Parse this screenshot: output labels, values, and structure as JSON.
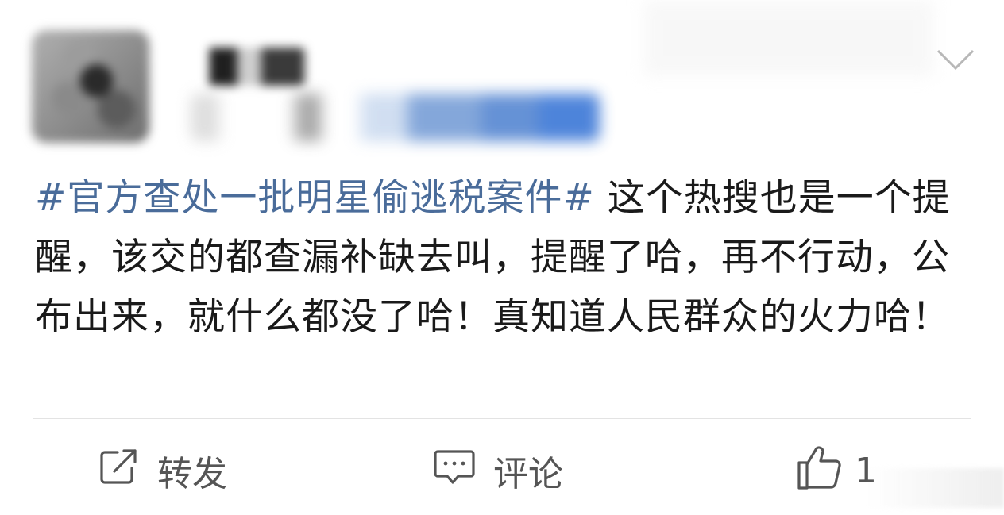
{
  "post": {
    "hashtag": "#官方查处一批明星偷逃税案件#",
    "text_first": " 这个热搜也是一个提醒，该交的都查漏补缺去叫，提醒了哈，再不行动，公布出来，就什么都没了哈！真知道人民群众的火力哈！"
  },
  "actions": {
    "forward_label": "转发",
    "comment_label": "评论",
    "like_count": "1"
  },
  "icons": {
    "forward": "share-edit-icon",
    "comment": "comment-bubble-icon",
    "like": "thumbs-up-icon",
    "menu": "chevron-down-icon"
  },
  "colors": {
    "hashtag": "#4a6c9a",
    "text": "#1a1a1a",
    "action_text": "#555555",
    "divider": "#e3e3e3"
  }
}
